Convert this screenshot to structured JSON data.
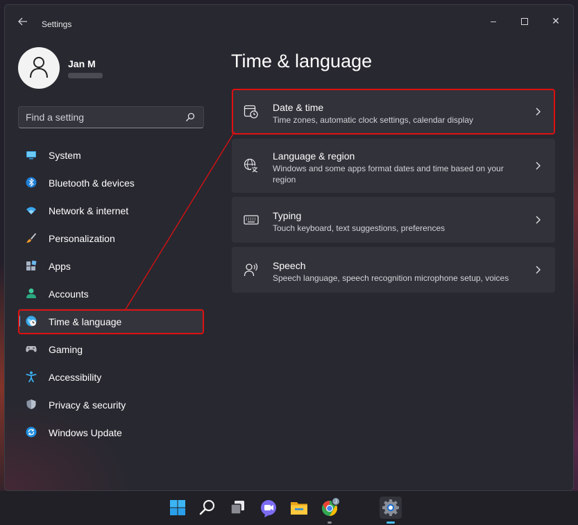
{
  "window": {
    "title": "Settings",
    "back_icon": "back-arrow-icon",
    "controls": {
      "minimize": "–",
      "close": "✕"
    }
  },
  "profile": {
    "name": "Jan M"
  },
  "search": {
    "placeholder": "Find a setting"
  },
  "nav": {
    "items": [
      {
        "label": "System",
        "icon": "system-icon",
        "active": false
      },
      {
        "label": "Bluetooth & devices",
        "icon": "bluetooth-icon",
        "active": false
      },
      {
        "label": "Network & internet",
        "icon": "wifi-icon",
        "active": false
      },
      {
        "label": "Personalization",
        "icon": "brush-icon",
        "active": false
      },
      {
        "label": "Apps",
        "icon": "apps-icon",
        "active": false
      },
      {
        "label": "Accounts",
        "icon": "account-icon",
        "active": false
      },
      {
        "label": "Time & language",
        "icon": "globe-clock-icon",
        "active": true
      },
      {
        "label": "Gaming",
        "icon": "gamepad-icon",
        "active": false
      },
      {
        "label": "Accessibility",
        "icon": "accessibility-icon",
        "active": false
      },
      {
        "label": "Privacy & security",
        "icon": "shield-icon",
        "active": false
      },
      {
        "label": "Windows Update",
        "icon": "update-icon",
        "active": false
      }
    ]
  },
  "main": {
    "title": "Time & language",
    "cards": [
      {
        "title": "Date & time",
        "description": "Time zones, automatic clock settings, calendar display",
        "icon": "calendar-clock-icon"
      },
      {
        "title": "Language & region",
        "description": "Windows and some apps format dates and time based on your region",
        "icon": "language-icon"
      },
      {
        "title": "Typing",
        "description": "Touch keyboard, text suggestions, preferences",
        "icon": "keyboard-icon"
      },
      {
        "title": "Speech",
        "description": "Speech language, speech recognition microphone setup, voices",
        "icon": "speech-icon"
      }
    ]
  },
  "colors": {
    "accent": "#4cc2ff",
    "highlight": "#e01010",
    "window_bg": "#282830",
    "card_bg": "#32323a"
  },
  "taskbar": {
    "icons": [
      "windows-start-icon",
      "search-icon",
      "task-view-icon",
      "teams-chat-icon",
      "file-explorer-icon",
      "chrome-icon",
      "settings-gear-icon"
    ],
    "chrome_profile_badge": "J"
  }
}
